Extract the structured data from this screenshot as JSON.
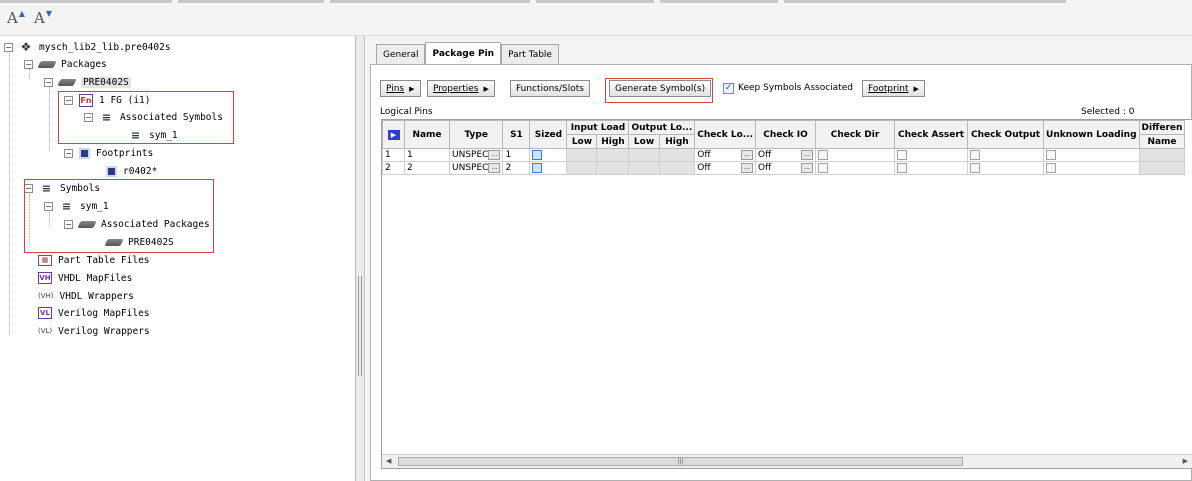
{
  "toolbar": {
    "font_increase_label": "A",
    "font_decrease_label": "A"
  },
  "tree": {
    "root": "mysch_lib2_lib.pre0402s",
    "packages": "Packages",
    "package_name": "PRE0402S",
    "function_group": "1 FG (i1)",
    "function_group_icon": "Fn",
    "associated_symbols": "Associated Symbols",
    "symbol_child": "sym_1",
    "footprints": "Footprints",
    "footprint_child": "r0402*",
    "symbols": "Symbols",
    "symbol_name": "sym_1",
    "associated_packages": "Associated Packages",
    "assoc_package_child": "PRE0402S",
    "part_table_files": "Part Table Files",
    "vhdl_mapfiles": "VHDL MapFiles",
    "vhdl_wrappers": "VHDL Wrappers",
    "verilog_mapfiles": "Verilog MapFiles",
    "verilog_wrappers": "Verilog Wrappers",
    "icon_vh": "VH",
    "icon_vh_paren": "(VH)",
    "icon_vl": "VL",
    "icon_vl_paren": "(VL)"
  },
  "tabs": {
    "general": "General",
    "package_pin": "Package Pin",
    "part_table": "Part Table"
  },
  "buttons": {
    "pins": "Pins",
    "properties": "Properties",
    "functions_slots": "Functions/Slots",
    "generate_symbols": "Generate Symbol(s)",
    "keep_symbols_associated": "Keep Symbols Associated",
    "footprint": "Footprint"
  },
  "logical_pins_label": "Logical Pins",
  "selected_label": "Selected :  0",
  "grid": {
    "headers": {
      "name": "Name",
      "type": "Type",
      "s1": "S1",
      "sized": "Sized",
      "input_load": "Input Load",
      "output_load": "Output Lo...",
      "low": "Low",
      "high": "High",
      "check_lo": "Check Lo...",
      "check_io": "Check IO",
      "check_dir": "Check Dir",
      "check_assert": "Check Assert",
      "check_output": "Check Output",
      "unknown_loading": "Unknown Loading",
      "differen": "Differen",
      "diff_name": "Name"
    },
    "rows": [
      {
        "num": "1",
        "name": "1",
        "type": "UNSPEC",
        "s1": "1",
        "check_lo": "Off",
        "check_io": "Off"
      },
      {
        "num": "2",
        "name": "2",
        "type": "UNSPEC",
        "s1": "2",
        "check_lo": "Off",
        "check_io": "Off"
      }
    ]
  },
  "scrollbar_grip": "|||"
}
